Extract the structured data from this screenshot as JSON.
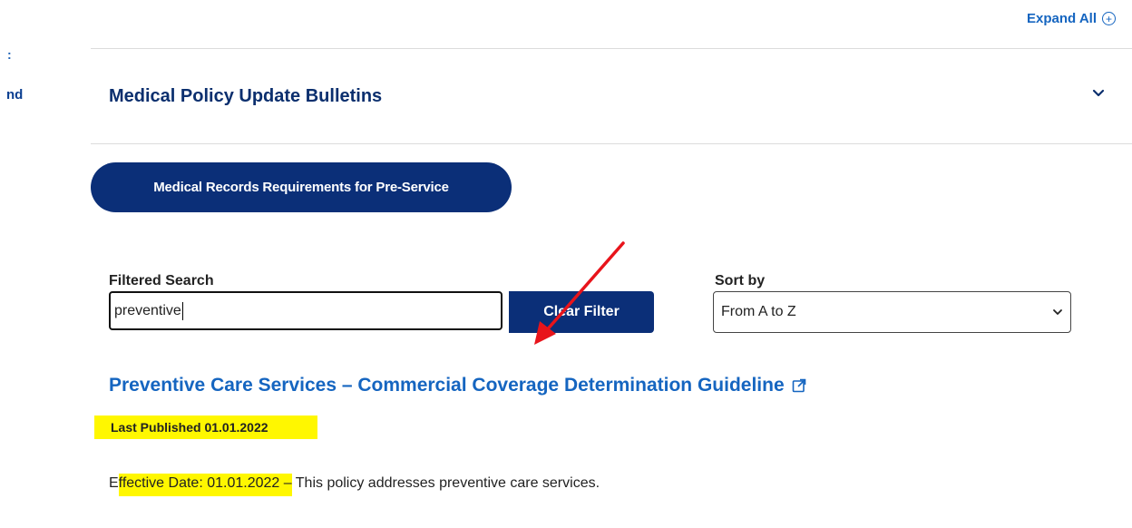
{
  "nav_fragments": {
    "top": ":",
    "bottom": "nd"
  },
  "header": {
    "expand_all_label": "Expand All",
    "expand_icon": "plus-circle-icon"
  },
  "accordion": {
    "title": "Medical Policy Update Bulletins",
    "chevron_icon": "chevron-down-icon"
  },
  "pill_button": {
    "label": "Medical Records Requirements for Pre-Service"
  },
  "filter": {
    "label": "Filtered Search",
    "value": "preventive",
    "clear_label": "Clear Filter"
  },
  "sort": {
    "label": "Sort by",
    "selected": "From A to Z"
  },
  "result": {
    "title": "Preventive Care Services – Commercial Coverage Determination Guideline",
    "link_icon": "external-link-icon",
    "last_published": "Last Published 01.01.2022",
    "effective_prefix": "E",
    "effective_highlight": "ffective Date: 01.01.2022 –",
    "effective_rest": " This policy addresses preventive care services."
  },
  "colors": {
    "brand_navy": "#0b2f78",
    "link_blue": "#1565c0",
    "highlight_yellow": "#fff700",
    "annotation_red": "#e8141b"
  }
}
